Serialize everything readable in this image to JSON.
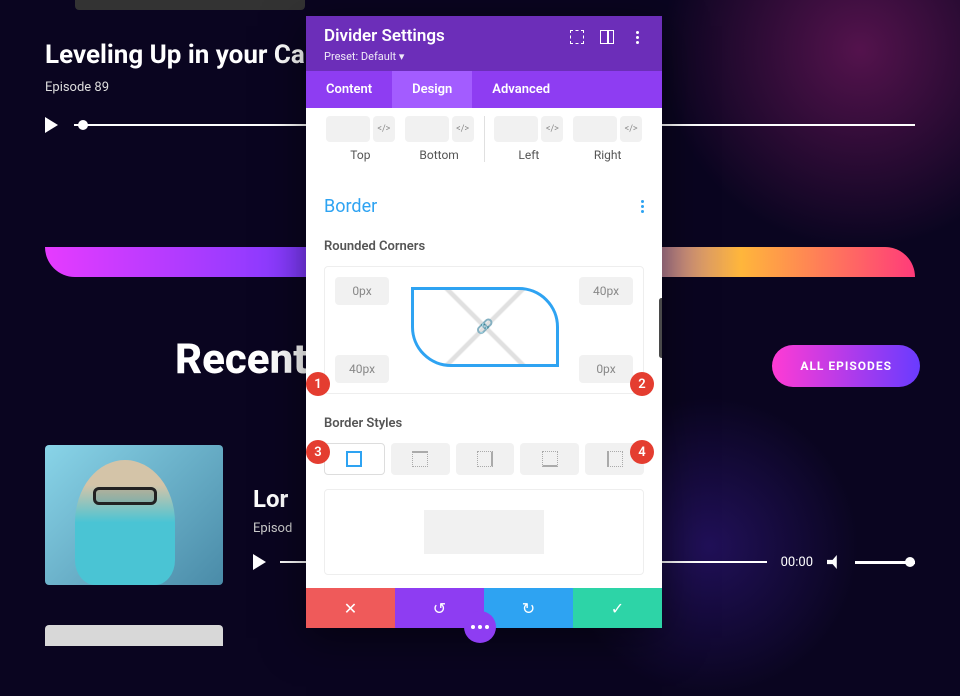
{
  "hero": {
    "title": "Leveling Up in your Career, w",
    "subtitle": "Episode 89"
  },
  "recent": {
    "heading": "Recent",
    "all_button": "ALL EPISODES"
  },
  "episode": {
    "title": "Lor",
    "subtitle": "Episod",
    "time": "00:00"
  },
  "modal": {
    "title": "Divider Settings",
    "preset": "Preset: Default ▾",
    "tabs": {
      "content": "Content",
      "design": "Design",
      "advanced": "Advanced"
    },
    "margins": {
      "top": "Top",
      "bottom": "Bottom",
      "left": "Left",
      "right": "Right",
      "code": "</>"
    },
    "border": {
      "title": "Border",
      "rounded_label": "Rounded Corners",
      "tl": "0px",
      "tr": "40px",
      "bl": "40px",
      "br": "0px",
      "styles_label": "Border Styles"
    },
    "footer": {
      "cancel": "✕",
      "undo": "↺",
      "redo": "↻",
      "save": "✓"
    },
    "badges": {
      "b1": "1",
      "b2": "2",
      "b3": "3",
      "b4": "4"
    }
  }
}
